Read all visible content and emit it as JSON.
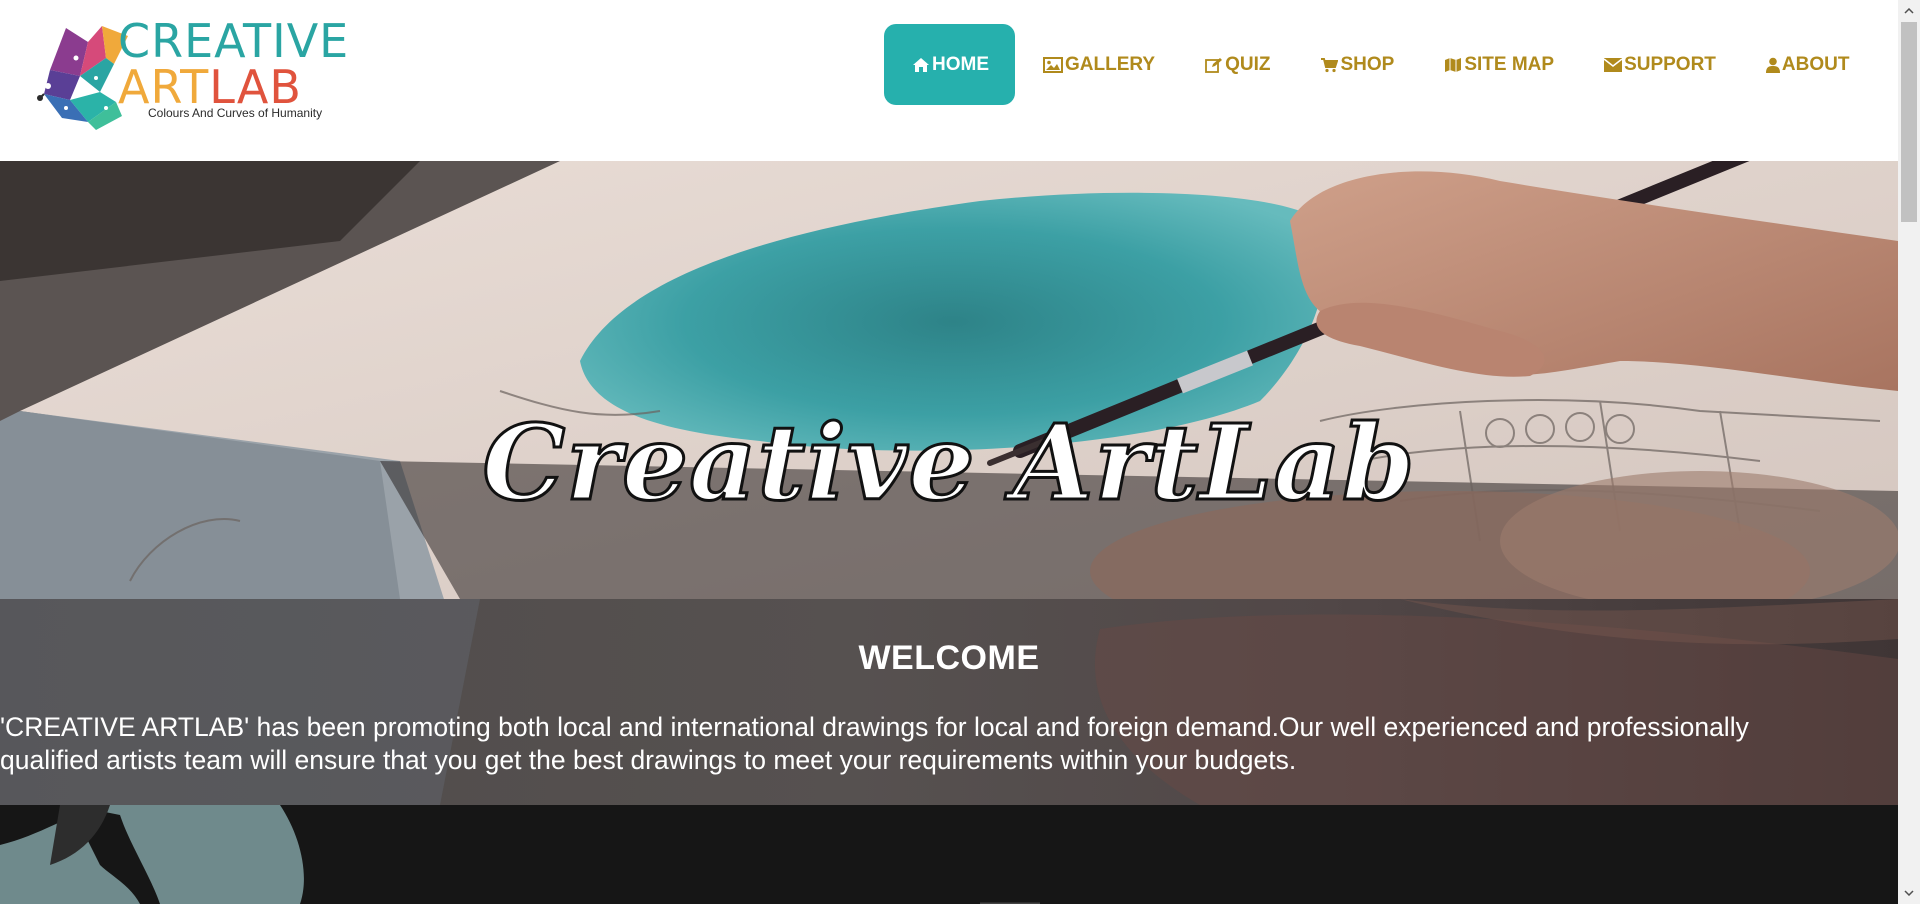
{
  "header": {
    "logo": {
      "line1": "CREATIVE",
      "line2_art": "ART",
      "line2_lab": "LAB",
      "tagline": "Colours And Curves of Humanity"
    },
    "nav": [
      {
        "label": "HOME",
        "icon": "home-icon",
        "active": true
      },
      {
        "label": "GALLERY",
        "icon": "image-icon",
        "active": false
      },
      {
        "label": "QUIZ",
        "icon": "edit-icon",
        "active": false
      },
      {
        "label": "SHOP",
        "icon": "cart-icon",
        "active": false
      },
      {
        "label": "SITE MAP",
        "icon": "map-icon",
        "active": false
      },
      {
        "label": "SUPPORT",
        "icon": "envelope-icon",
        "active": false
      },
      {
        "label": "ABOUT",
        "icon": "user-icon",
        "active": false
      }
    ]
  },
  "hero": {
    "title": "Creative ArtLab"
  },
  "welcome": {
    "title": "WELCOME",
    "line1": "'CREATIVE ARTLAB' has been promoting both local and international drawings for local and foreign demand.Our well experienced and professionally",
    "line2": "qualified artists team will ensure that you get the best drawings to meet your requirements within your budgets."
  },
  "colors": {
    "accent": "#26b0ad",
    "nav_text": "#b08a1c",
    "logo_teal": "#2aa5a3",
    "logo_orange": "#f0a93b",
    "logo_red": "#e0533d"
  }
}
